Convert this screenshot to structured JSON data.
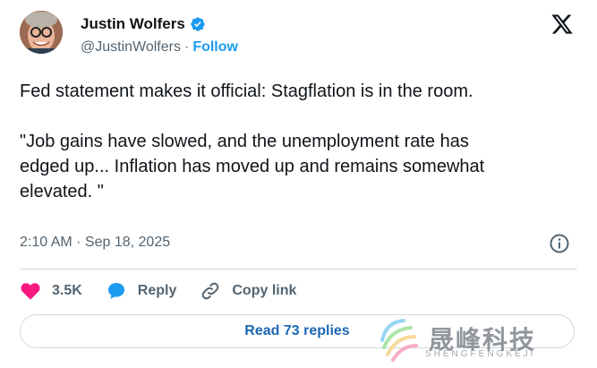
{
  "author": {
    "name": "Justin Wolfers",
    "handle": "@JustinWolfers",
    "separator": "·",
    "follow_label": "Follow"
  },
  "tweet": {
    "line1": "Fed statement makes it official: Stagflation is in the room.",
    "quote": "\"Job gains have slowed, and the unemployment rate has\nedged up... Inflation has moved up and remains somewhat\nelevated. \""
  },
  "meta": {
    "time": "2:10 AM · Sep 18, 2025"
  },
  "actions": {
    "likes": "3.5K",
    "reply_label": "Reply",
    "copy_link_label": "Copy link"
  },
  "read_replies_label": "Read 73 replies",
  "watermark": {
    "title": "晟峰科技",
    "subtitle": "SHENGFENGKEJI"
  },
  "colors": {
    "accent": "#1d9bf0",
    "like": "#f91880",
    "text": "#0f1419",
    "muted": "#536471"
  },
  "icons": [
    "verified-badge-icon",
    "x-logo-icon",
    "info-icon",
    "heart-icon",
    "reply-bubble-icon",
    "link-icon"
  ]
}
